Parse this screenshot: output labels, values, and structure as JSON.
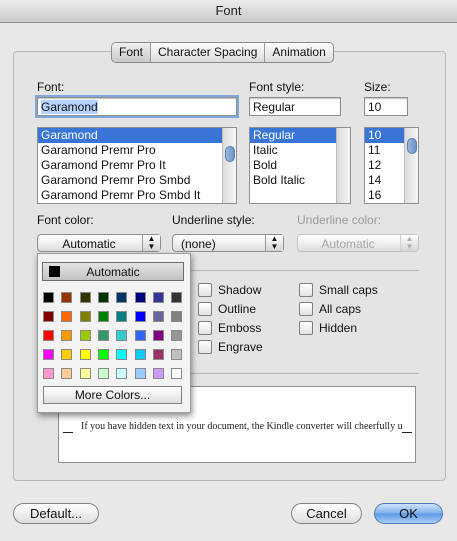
{
  "window": {
    "title": "Font"
  },
  "tabs": [
    {
      "label": "Font",
      "active": true
    },
    {
      "label": "Character Spacing",
      "active": false
    },
    {
      "label": "Animation",
      "active": false
    }
  ],
  "font": {
    "label": "Font:",
    "value": "Garamond",
    "list": [
      "Garamond",
      "Garamond Premr Pro",
      "Garamond Premr Pro It",
      "Garamond Premr Pro Smbd",
      "Garamond Premr Pro Smbd It"
    ],
    "selected_index": 0
  },
  "font_style": {
    "label": "Font style:",
    "value": "Regular",
    "list": [
      "Regular",
      "Italic",
      "Bold",
      "Bold Italic"
    ],
    "selected_index": 0
  },
  "size": {
    "label": "Size:",
    "value": "10",
    "list": [
      "10",
      "11",
      "12",
      "14",
      "16"
    ],
    "selected_index": 0
  },
  "font_color": {
    "label": "Font color:",
    "value": "Automatic"
  },
  "underline_style": {
    "label": "Underline style:",
    "value": "(none)"
  },
  "underline_color": {
    "label": "Underline color:",
    "value": "Automatic"
  },
  "effects": {
    "col1": [
      "Shadow",
      "Outline",
      "Emboss",
      "Engrave"
    ],
    "col2": [
      "Small caps",
      "All caps",
      "Hidden"
    ]
  },
  "preview": {
    "text": "If you have hidden text in your document, the Kindle converter will cheerfully u"
  },
  "color_popup": {
    "automatic_label": "Automatic",
    "more_label": "More Colors...",
    "swatches": [
      [
        "#000000",
        "#993300",
        "#333300",
        "#003300",
        "#003366",
        "#000080",
        "#333399",
        "#333333"
      ],
      [
        "#800000",
        "#ff6600",
        "#808000",
        "#008000",
        "#008080",
        "#0000ff",
        "#666699",
        "#808080"
      ],
      [
        "#ff0000",
        "#ff9900",
        "#99cc00",
        "#339966",
        "#33cccc",
        "#3366ff",
        "#800080",
        "#969696"
      ],
      [
        "#ff00ff",
        "#ffcc00",
        "#ffff00",
        "#00ff00",
        "#00ffff",
        "#00ccff",
        "#993366",
        "#c0c0c0"
      ],
      [
        "#ff99cc",
        "#ffcc99",
        "#ffff99",
        "#ccffcc",
        "#ccffff",
        "#99ccff",
        "#cc99ff",
        "#ffffff"
      ]
    ]
  },
  "buttons": {
    "default": "Default...",
    "cancel": "Cancel",
    "ok": "OK"
  }
}
